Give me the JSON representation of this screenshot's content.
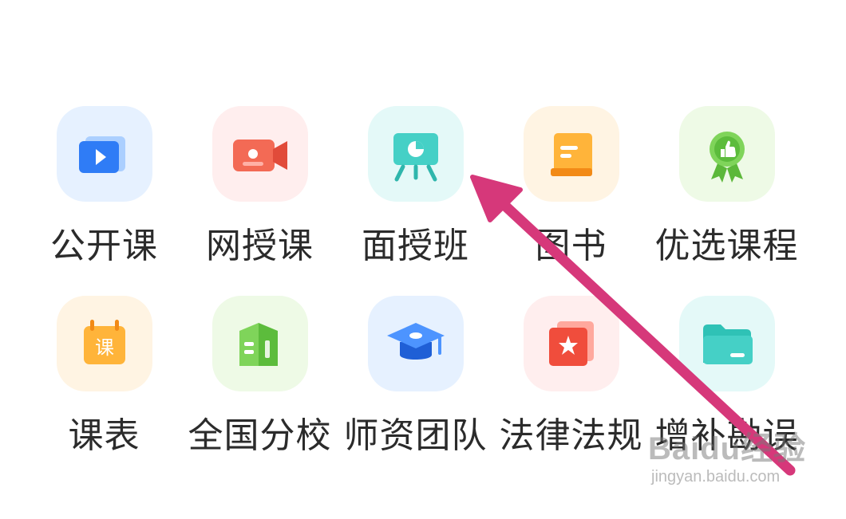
{
  "menu": {
    "items": [
      {
        "label": "公开课",
        "icon": "play-video-icon",
        "tile_color": "#e6f1ff"
      },
      {
        "label": "网授课",
        "icon": "video-camera-icon",
        "tile_color": "#ffeeee"
      },
      {
        "label": "面授班",
        "icon": "presentation-board-icon",
        "tile_color": "#e4f9f8"
      },
      {
        "label": "图书",
        "icon": "book-icon",
        "tile_color": "#fff4e3"
      },
      {
        "label": "优选课程",
        "icon": "award-medal-icon",
        "tile_color": "#eefae6"
      },
      {
        "label": "课表",
        "icon": "calendar-icon",
        "tile_color": "#fff4e3"
      },
      {
        "label": "全国分校",
        "icon": "map-building-icon",
        "tile_color": "#eefae6"
      },
      {
        "label": "师资团队",
        "icon": "graduation-cap-icon",
        "tile_color": "#e6f1ff"
      },
      {
        "label": "法律法规",
        "icon": "star-folder-icon",
        "tile_color": "#ffeeee"
      },
      {
        "label": "增补勘误",
        "icon": "folder-icon",
        "tile_color": "#e4f9f8"
      }
    ],
    "calendar_glyph": "课"
  },
  "annotation": {
    "arrow_color": "#d6387a"
  },
  "watermark": {
    "main": "Baidu经验",
    "sub": "jingyan.baidu.com"
  }
}
